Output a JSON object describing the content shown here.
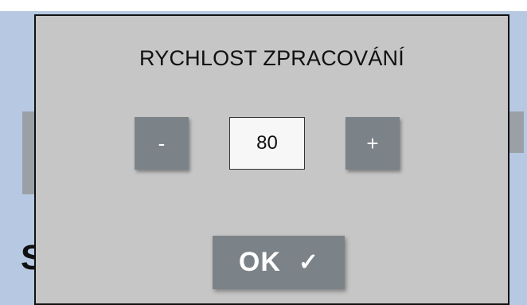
{
  "dialog": {
    "title": "RYCHLOST ZPRACOVÁNÍ",
    "decrement_label": "-",
    "value": "80",
    "increment_label": "+",
    "ok_label": "OK",
    "ok_icon": "check-icon"
  },
  "background": {
    "partial_letter": "S"
  },
  "colors": {
    "dialog_bg": "#c6c6c6",
    "button_bg": "#7b8288",
    "app_bg": "#b6c8e2"
  }
}
